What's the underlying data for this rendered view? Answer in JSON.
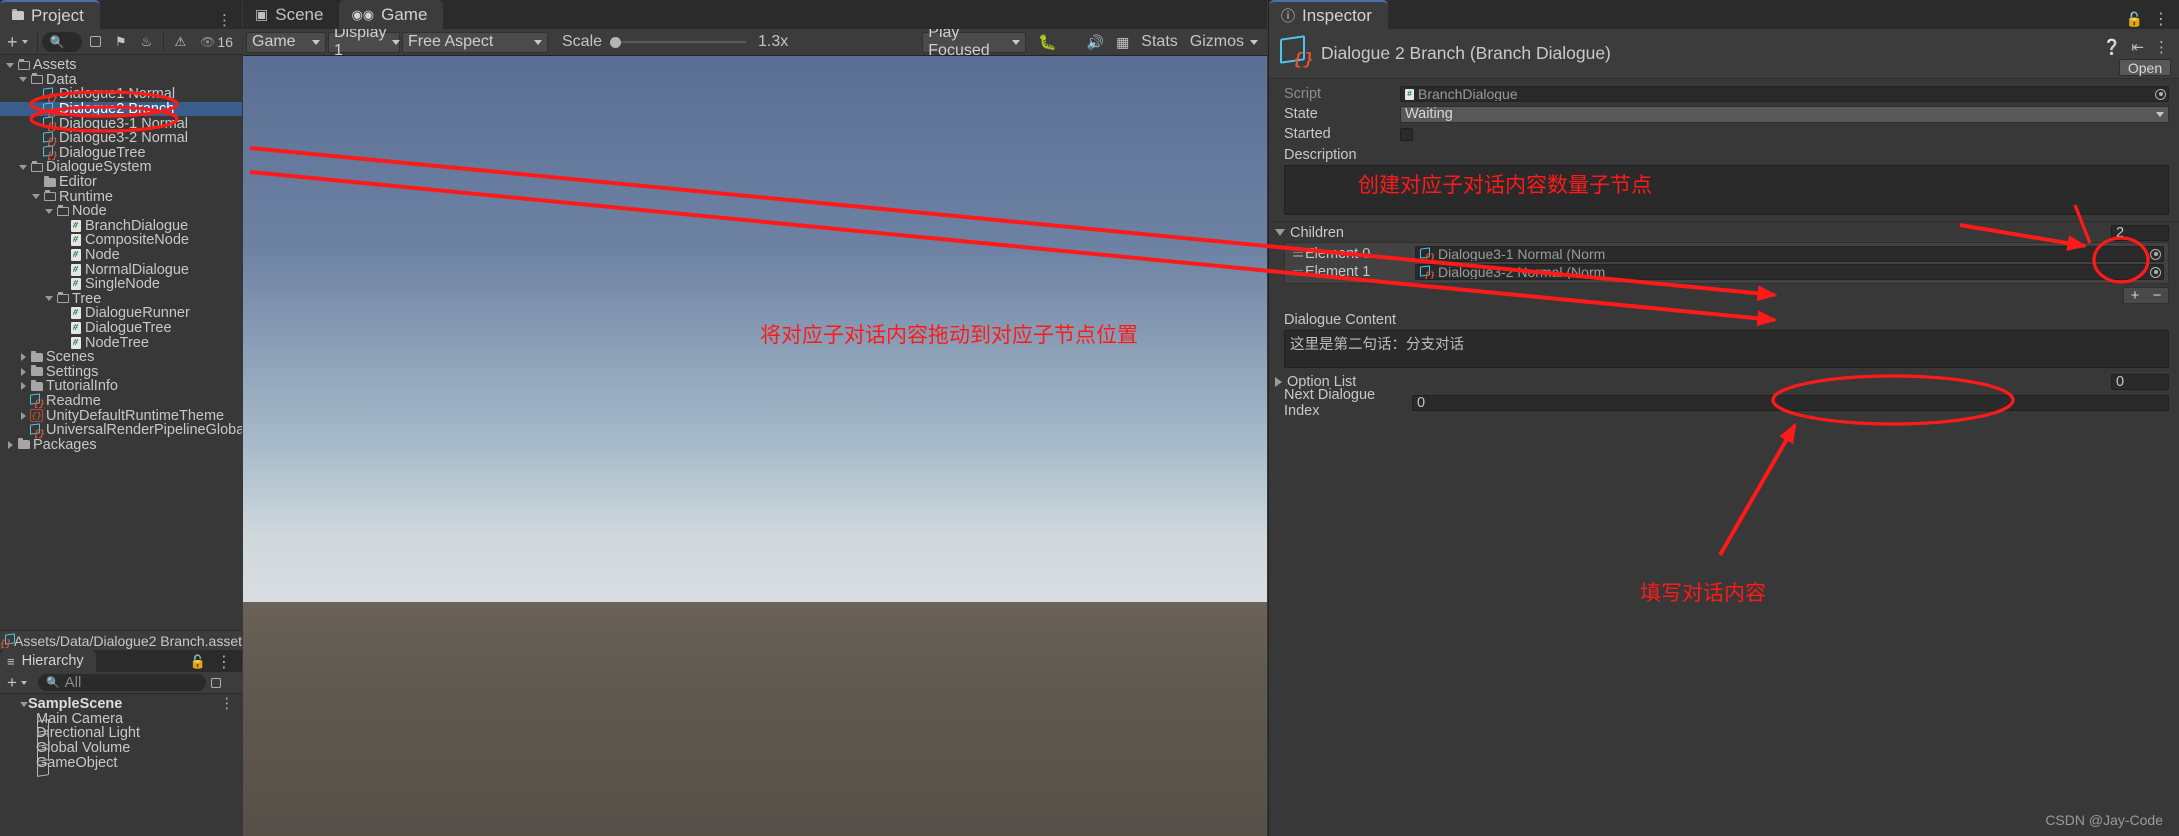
{
  "project": {
    "tab_label": "Project",
    "tab_icon": "folder-icon",
    "toolbar": {
      "add_label": "+",
      "search_placeholder": "",
      "search_icon": "search-icon",
      "favorite_icon": "star-icon",
      "label_icon": "tag-icon",
      "history_icon": "clock-icon",
      "warning_icon": "warning-icon",
      "hidden_count": "16",
      "hidden_icon": "eye-off-icon"
    },
    "tree": [
      {
        "label": "Assets",
        "depth": 0,
        "icon": "folder-open-icon",
        "expanded": true,
        "selected": false
      },
      {
        "label": "Data",
        "depth": 1,
        "icon": "folder-open-icon",
        "expanded": true,
        "selected": false
      },
      {
        "label": "Dialogue1 Normal",
        "depth": 2,
        "icon": "scriptable-object-icon",
        "expanded": null,
        "selected": false
      },
      {
        "label": "Dialogue2 Branch",
        "depth": 2,
        "icon": "scriptable-object-icon",
        "expanded": null,
        "selected": true
      },
      {
        "label": "Dialogue3-1 Normal",
        "depth": 2,
        "icon": "scriptable-object-icon",
        "expanded": null,
        "selected": false
      },
      {
        "label": "Dialogue3-2 Normal",
        "depth": 2,
        "icon": "scriptable-object-icon",
        "expanded": null,
        "selected": false
      },
      {
        "label": "DialogueTree",
        "depth": 2,
        "icon": "scriptable-object-icon",
        "expanded": null,
        "selected": false
      },
      {
        "label": "DialogueSystem",
        "depth": 1,
        "icon": "folder-open-icon",
        "expanded": true,
        "selected": false
      },
      {
        "label": "Editor",
        "depth": 2,
        "icon": "folder-icon",
        "expanded": null,
        "selected": false
      },
      {
        "label": "Runtime",
        "depth": 2,
        "icon": "folder-open-icon",
        "expanded": true,
        "selected": false
      },
      {
        "label": "Node",
        "depth": 3,
        "icon": "folder-open-icon",
        "expanded": true,
        "selected": false
      },
      {
        "label": "BranchDialogue",
        "depth": 4,
        "icon": "csharp-icon",
        "expanded": null,
        "selected": false
      },
      {
        "label": "CompositeNode",
        "depth": 4,
        "icon": "csharp-icon",
        "expanded": null,
        "selected": false
      },
      {
        "label": "Node",
        "depth": 4,
        "icon": "csharp-icon",
        "expanded": null,
        "selected": false
      },
      {
        "label": "NormalDialogue",
        "depth": 4,
        "icon": "csharp-icon",
        "expanded": null,
        "selected": false
      },
      {
        "label": "SingleNode",
        "depth": 4,
        "icon": "csharp-icon",
        "expanded": null,
        "selected": false
      },
      {
        "label": "Tree",
        "depth": 3,
        "icon": "folder-open-icon",
        "expanded": true,
        "selected": false
      },
      {
        "label": "DialogueRunner",
        "depth": 4,
        "icon": "csharp-icon",
        "expanded": null,
        "selected": false
      },
      {
        "label": "DialogueTree",
        "depth": 4,
        "icon": "csharp-icon",
        "expanded": null,
        "selected": false
      },
      {
        "label": "NodeTree",
        "depth": 4,
        "icon": "csharp-icon",
        "expanded": null,
        "selected": false
      },
      {
        "label": "Scenes",
        "depth": 1,
        "icon": "folder-icon",
        "expanded": false,
        "selected": false
      },
      {
        "label": "Settings",
        "depth": 1,
        "icon": "folder-icon",
        "expanded": false,
        "selected": false
      },
      {
        "label": "TutorialInfo",
        "depth": 1,
        "icon": "folder-icon",
        "expanded": false,
        "selected": false
      },
      {
        "label": "Readme",
        "depth": 1,
        "icon": "scriptable-object-icon",
        "expanded": null,
        "selected": false
      },
      {
        "label": "UnityDefaultRuntimeTheme",
        "depth": 1,
        "icon": "uss-theme-icon",
        "expanded": false,
        "selected": false
      },
      {
        "label": "UniversalRenderPipelineGlobalSetting",
        "depth": 1,
        "icon": "scriptable-object-icon",
        "expanded": null,
        "selected": false
      },
      {
        "label": "Packages",
        "depth": 0,
        "icon": "folder-icon",
        "expanded": false,
        "selected": false
      }
    ],
    "path_bar": {
      "icon": "scriptable-object-icon",
      "text": "Assets/Data/Dialogue2 Branch.asset"
    }
  },
  "hierarchy": {
    "tab_label": "Hierarchy",
    "tab_icon": "hierarchy-icon",
    "toolbar": {
      "add_label": "+",
      "search_placeholder": "All",
      "search_icon": "search-icon"
    },
    "items": [
      {
        "label": "SampleScene",
        "depth": 0,
        "icon": "unity-scene-icon",
        "expanded": true,
        "bold": true
      },
      {
        "label": "Main Camera",
        "depth": 1,
        "icon": "gameobject-icon",
        "expanded": null,
        "bold": false
      },
      {
        "label": "Directional Light",
        "depth": 1,
        "icon": "gameobject-icon",
        "expanded": null,
        "bold": false
      },
      {
        "label": "Global Volume",
        "depth": 1,
        "icon": "gameobject-icon",
        "expanded": null,
        "bold": false
      },
      {
        "label": "GameObject",
        "depth": 1,
        "icon": "gameobject-icon",
        "expanded": null,
        "bold": false
      }
    ]
  },
  "center": {
    "tabs": [
      {
        "label": "Scene",
        "icon": "scene-grid-icon",
        "active": false
      },
      {
        "label": "Game",
        "icon": "gamepad-icon",
        "active": true
      }
    ],
    "toolbar": {
      "view_mode": "Game",
      "display": "Display 1",
      "aspect": "Free Aspect",
      "scale_label": "Scale",
      "scale_value": "1.3x",
      "play_focus": "Play Focused",
      "bug_icon": "bug-icon",
      "mute_icon": "speaker-icon",
      "stats_label": "Stats",
      "gizmos_label": "Gizmos",
      "grid_icon": "grid-icon"
    }
  },
  "inspector": {
    "tab_label": "Inspector",
    "tab_icon": "info-icon",
    "lock_icon": "lock-icon",
    "menu_icon": "kebab-menu-icon",
    "object_title": "Dialogue 2 Branch (Branch Dialogue)",
    "object_icon": "scriptable-object-icon",
    "help_icon": "help-icon",
    "preset_icon": "preset-icon",
    "open_label": "Open",
    "properties": {
      "script_label": "Script",
      "script_value": "BranchDialogue",
      "state_label": "State",
      "state_value": "Waiting",
      "started_label": "Started",
      "started_checked": false,
      "description_label": "Description",
      "description_value": "",
      "children_label": "Children",
      "children_count": "2",
      "children": [
        {
          "element_label": "Element 0",
          "value": "Dialogue3-1 Normal (Norm"
        },
        {
          "element_label": "Element 1",
          "value": "Dialogue3-2 Normal (Norm"
        }
      ],
      "add_label": "+",
      "remove_label": "−",
      "dialogue_content_label": "Dialogue Content",
      "dialogue_content_value": "这里是第二句话：分支对话",
      "option_list_label": "Option List",
      "option_list_count": "0",
      "next_dialogue_index_label": "Next Dialogue Index",
      "next_dialogue_index_value": "0"
    }
  },
  "annotations": {
    "color": "#ff1a1a",
    "texts": [
      {
        "id": "anno-create-children",
        "text": "创建对应子对话内容数量子节点"
      },
      {
        "id": "anno-drag-content",
        "text": "将对应子对话内容拖动到对应子节点位置"
      },
      {
        "id": "anno-fill-content",
        "text": "填写对话内容"
      }
    ]
  },
  "watermark": "CSDN @Jay-Code"
}
